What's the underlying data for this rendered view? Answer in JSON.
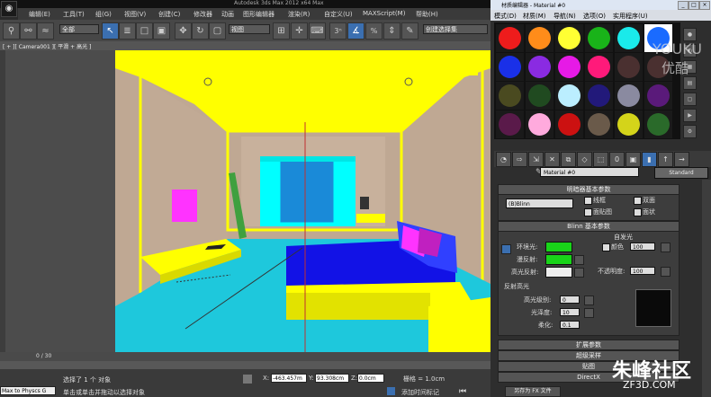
{
  "app": {
    "title": "Autodesk 3ds Max  2012    x64  Max",
    "logo": "3ds-max-logo"
  },
  "menubar": [
    "编辑(E)",
    "工具(T)",
    "组(G)",
    "视图(V)",
    "创建(C)",
    "修改器",
    "动画",
    "图形编辑器",
    "渲染(R)",
    "自定义(U)",
    "MAXScript(M)",
    "帮助(H)"
  ],
  "toolbar": {
    "filter": "全部",
    "view": "视图",
    "selection_set": "创建选择集",
    "snap": "3",
    "angle": "%"
  },
  "viewport": {
    "label": "[ + ][ Camera001 ][ 平滑 + 高光 ]",
    "colors": {
      "yellow": "#ffff00",
      "cyan": "#00ffff",
      "blue": "#1010e8",
      "magenta": "#ff33ff",
      "tan": "#bfa893",
      "green": "#3fa03f"
    }
  },
  "timeline": {
    "frame": "0 / 30"
  },
  "status": {
    "script_label": "Max to Physcs G",
    "selected": "选择了 1 个 对象",
    "prompt": "单击或单击并拖动以选择对象",
    "x_label": "X:",
    "x_value": "-463.457m",
    "y_label": "Y:",
    "y_value": "93.308cm",
    "z_label": "Z:",
    "z_value": "0.0cm",
    "grid": "栅格 = 1.0cm",
    "add_tag": "添加时间标记"
  },
  "material_editor": {
    "title": "材质编辑器 - Material #0",
    "menu": [
      "模式(D)",
      "材质(M)",
      "导航(N)",
      "选项(O)",
      "实用程序(U)"
    ],
    "slots": [
      "#ee1c1c",
      "#ff8c1a",
      "#ffff33",
      "#19b319",
      "#1aeaea",
      "#1a6bff",
      "#1a30e8",
      "#8a2be2",
      "#e61ae6",
      "#ff1a7a",
      "#4a3030",
      "#4a3030",
      "#4a4a20",
      "#204a20",
      "#bbeeff",
      "#22197a",
      "#8a8aa0",
      "#5a1a7a",
      "#5a1a4a",
      "#ffaadd",
      "#cc1111",
      "#6a5a4a",
      "#d4d41a",
      "#2a6a2a"
    ],
    "material_name": "Material #0",
    "material_type": "Standard",
    "shader_rollout": "明暗器基本参数",
    "shader": "(B)Blinn",
    "wire": "线框",
    "two_sided": "双面",
    "face_map": "面贴图",
    "faceted": "面状",
    "blinn_rollout": "Blinn 基本参数",
    "self_illum": "自发光",
    "ambient": "环境光:",
    "diffuse": "漫反射:",
    "specular": "高光反射:",
    "color_label": "颜色",
    "color_value": "100",
    "opacity_label": "不透明度:",
    "opacity_value": "100",
    "spec_highlights": "反射高光",
    "spec_level": "高光级别:",
    "spec_level_value": "0",
    "glossiness": "光泽度:",
    "glossiness_value": "10",
    "soften": "柔化:",
    "soften_value": "0.1",
    "extended": "扩展参数",
    "supersampling": "超级采样",
    "maps": "贴图",
    "directx": "DirectX",
    "save_fx": "另存为 FX 文件",
    "swatches": {
      "ambient": "#19d419",
      "diffuse": "#19d419",
      "specular": "#eeeeee"
    }
  },
  "watermarks": {
    "youku": "YOUKU",
    "youku_cn": "优酷",
    "zf3d": "朱峰社区",
    "zf3d_url": "ZF3D.COM"
  }
}
